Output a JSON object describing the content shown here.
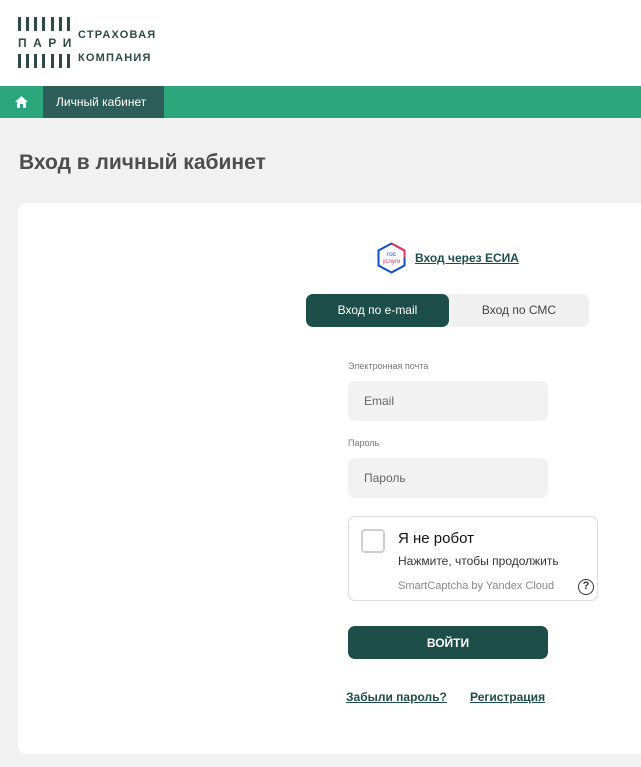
{
  "header": {
    "logo_brand": "ПАРИ",
    "logo_line1": "СТРАХОВАЯ",
    "logo_line2": "КОМПАНИЯ"
  },
  "navbar": {
    "home_icon": "home-icon",
    "active_item": "Личный кабинет"
  },
  "page": {
    "title": "Вход в личный кабинет"
  },
  "login": {
    "esia_logo_top": "гос",
    "esia_logo_bottom": "услуги",
    "esia_link": "Вход через ЕСИА",
    "tabs": [
      {
        "label": "Вход по e-mail",
        "active": true
      },
      {
        "label": "Вход по СМС",
        "active": false
      }
    ],
    "email_label": "Электронная почта",
    "email_placeholder": "Email",
    "password_label": "Пароль",
    "password_placeholder": "Пароль",
    "captcha": {
      "title": "Я не робот",
      "subtitle": "Нажмите, чтобы продолжить",
      "brand": "SmartCaptcha by Yandex Cloud",
      "help": "?"
    },
    "submit_label": "ВОЙТИ",
    "forgot_link": "Забыли пароль?",
    "register_link": "Регистрация"
  },
  "colors": {
    "nav_green": "#2ba57b",
    "dark_teal": "#1e4e49",
    "nav_active": "#2e5e59"
  }
}
